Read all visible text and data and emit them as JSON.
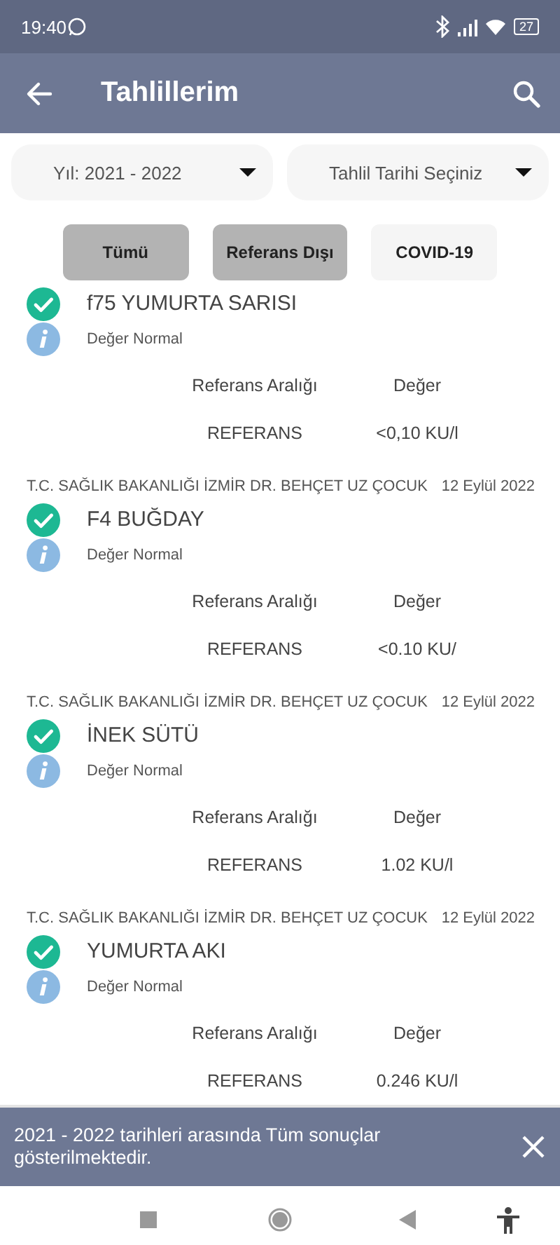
{
  "status_bar": {
    "time": "19:40",
    "battery": "27"
  },
  "app_bar": {
    "title": "Tahlillerim"
  },
  "filters": [
    {
      "label": "Yıl: 2021 - 2022"
    },
    {
      "label": "Tahlil Tarihi Seçiniz"
    }
  ],
  "chips": [
    {
      "label": "Tümü",
      "selected": true
    },
    {
      "label": "Referans Dışı",
      "selected": true
    },
    {
      "label": "COVID-19",
      "selected": false
    }
  ],
  "results": [
    {
      "name": "f75 YUMURTA SARISI",
      "status": "Değer Normal",
      "range_header": "Referans Aralığı",
      "value_header": "Değer",
      "range": "REFERANS",
      "value": "<0,10 KU/l"
    },
    {
      "hospital": "T.C. SAĞLIK BAKANLIĞI İZMİR DR. BEHÇET UZ ÇOCUK",
      "date": "12 Eylül 2022",
      "name": "F4 BUĞDAY",
      "status": "Değer Normal",
      "range_header": "Referans Aralığı",
      "value_header": "Değer",
      "range": "REFERANS",
      "value": "<0.10 KU/"
    },
    {
      "hospital": "T.C. SAĞLIK BAKANLIĞI İZMİR DR. BEHÇET UZ ÇOCUK",
      "date": "12 Eylül 2022",
      "name": "İNEK SÜTÜ",
      "status": "Değer Normal",
      "range_header": "Referans Aralığı",
      "value_header": "Değer",
      "range": "REFERANS",
      "value": "1.02 KU/l"
    },
    {
      "hospital": "T.C. SAĞLIK BAKANLIĞI İZMİR DR. BEHÇET UZ ÇOCUK",
      "date": "12 Eylül 2022",
      "name": "YUMURTA AKI",
      "status": "Değer Normal",
      "range_header": "Referans Aralığı",
      "value_header": "Değer",
      "range": "REFERANS",
      "value": "0.246 KU/l"
    }
  ],
  "snackbar": {
    "message": "2021 - 2022 tarihleri arasında Tüm sonuçlar gösterilmektedir."
  }
}
